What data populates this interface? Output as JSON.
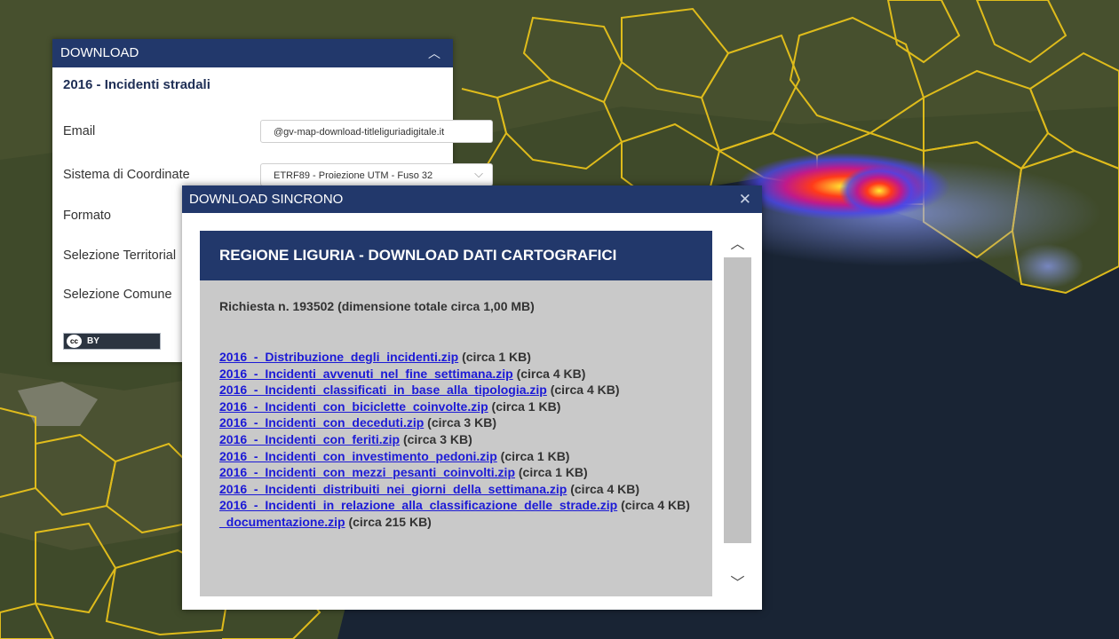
{
  "download_panel": {
    "title": "DOWNLOAD",
    "subtitle": "2016 - Incidenti stradali",
    "fields": {
      "email_label": "Email",
      "email_value": "@gv-map-download-titleliguriadigitale.it",
      "crs_label": "Sistema di Coordinate",
      "crs_value": "ETRF89 - Proiezione UTM - Fuso 32",
      "format_label": "Formato",
      "territory_label": "Selezione Territorial",
      "comune_label": "Selezione Comune"
    },
    "license_badge": "BY"
  },
  "sync_dialog": {
    "title": "DOWNLOAD SINCRONO",
    "banner": "REGIONE LIGURIA - DOWNLOAD DATI CARTOGRAFICI",
    "request": "Richiesta n. 193502 (dimensione totale circa 1,00 MB)",
    "files": [
      {
        "name": "2016_-_Distribuzione_degli_incidenti.zip",
        "size": "(circa 1 KB)"
      },
      {
        "name": "2016_-_Incidenti_avvenuti_nel_fine_settimana.zip",
        "size": "(circa 4 KB)"
      },
      {
        "name": "2016_-_Incidenti_classificati_in_base_alla_tipologia.zip",
        "size": "(circa 4 KB)"
      },
      {
        "name": "2016_-_Incidenti_con_biciclette_coinvolte.zip",
        "size": "(circa 1 KB)"
      },
      {
        "name": "2016_-_Incidenti_con_deceduti.zip",
        "size": "(circa 3 KB)"
      },
      {
        "name": "2016_-_Incidenti_con_feriti.zip",
        "size": "(circa 3 KB)"
      },
      {
        "name": "2016_-_Incidenti_con_investimento_pedoni.zip",
        "size": "(circa 1 KB)"
      },
      {
        "name": "2016_-_Incidenti_con_mezzi_pesanti_coinvolti.zip",
        "size": "(circa 1 KB)"
      },
      {
        "name": "2016_-_Incidenti_distribuiti_nei_giorni_della_settimana.zip",
        "size": "(circa 4 KB)"
      },
      {
        "name": "2016_-_Incidenti_in_relazione_alla_classificazione_delle_strade.zip",
        "size": "(circa 4 KB)"
      },
      {
        "name": "_documentazione.zip",
        "size": "(circa 215 KB)"
      }
    ]
  },
  "colors": {
    "header_bg": "#22386b",
    "link": "#1c1ad6",
    "content_bg": "#c9c9c9",
    "boundary": "#e8c21b"
  }
}
